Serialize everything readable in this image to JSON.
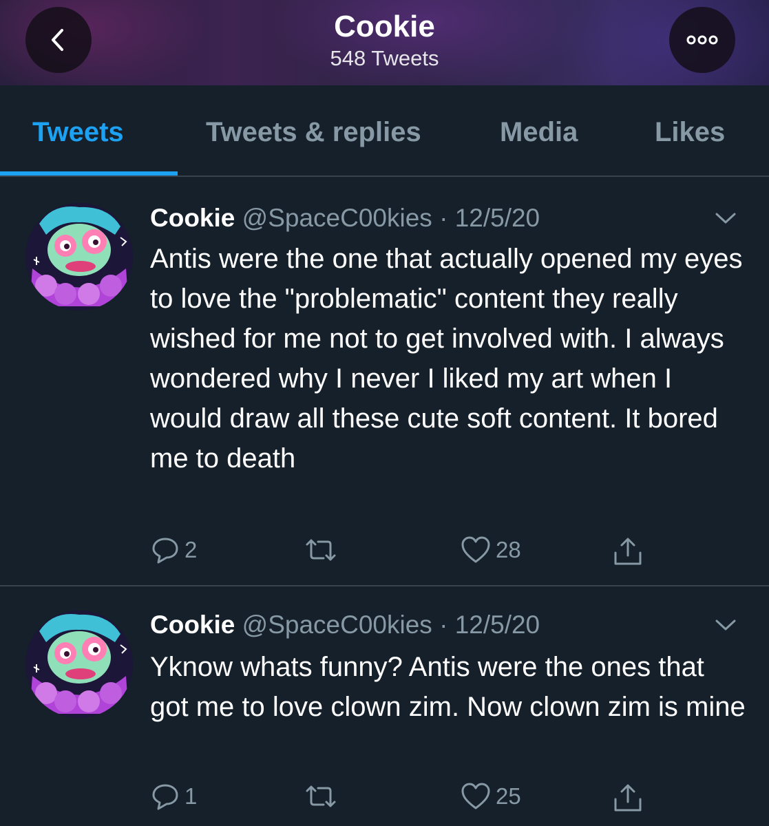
{
  "header": {
    "title": "Cookie",
    "subtitle": "548 Tweets",
    "back_icon": "chevron-left-icon",
    "more_icon": "more-dots-icon"
  },
  "tabs": [
    {
      "label": "Tweets",
      "active": true
    },
    {
      "label": "Tweets & replies",
      "active": false
    },
    {
      "label": "Media",
      "active": false
    },
    {
      "label": "Likes",
      "active": false
    }
  ],
  "colors": {
    "background": "#15202b",
    "accent": "#1da1f2",
    "secondary_text": "#8899a6",
    "divider": "#38444d"
  },
  "tweets": [
    {
      "name": "Cookie",
      "handle": "@SpaceC00kies",
      "separator": "·",
      "date": "12/5/20",
      "text": "Antis were the one that actually opened my eyes to love the \"problematic\" content they really wished for me not to get involved with. I always wondered why I never I liked my art when I would draw all these cute soft content. It bored me to death",
      "replies": "2",
      "retweets": "",
      "likes": "28"
    },
    {
      "name": "Cookie",
      "handle": "@SpaceC00kies",
      "separator": "·",
      "date": "12/5/20",
      "text": "Yknow whats funny? Antis were the ones that got me to love clown zim. Now clown zim is mine",
      "replies": "1",
      "retweets": "",
      "likes": "25"
    }
  ]
}
